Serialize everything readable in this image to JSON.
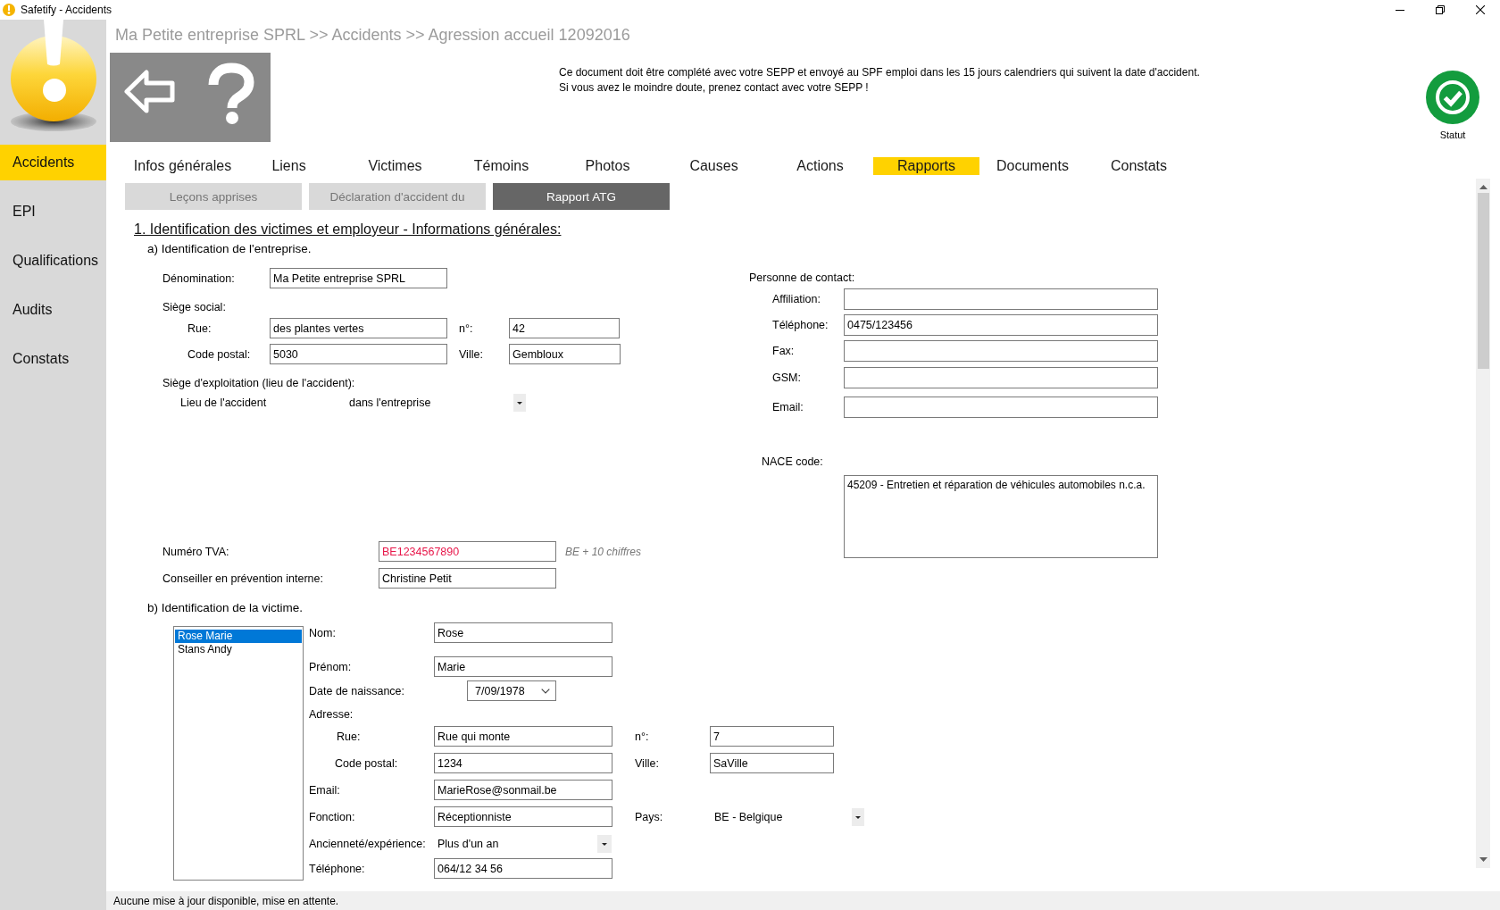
{
  "window": {
    "title": "Safetify - Accidents"
  },
  "sidebar": {
    "items": [
      {
        "label": "Accidents",
        "selected": true
      },
      {
        "label": "EPI",
        "selected": false
      },
      {
        "label": "Qualifications",
        "selected": false
      },
      {
        "label": "Audits",
        "selected": false
      },
      {
        "label": "Constats",
        "selected": false
      }
    ]
  },
  "breadcrumb": "Ma Petite entreprise SPRL >> Accidents >> Agression accueil 12092016",
  "notice": [
    "Ce document doit être complété avec votre SEPP et envoyé au SPF emploi dans les 15 jours calendriers qui suivent la date d'accident.",
    "Si vous avez le moindre doute, prenez contact avec votre SEPP !"
  ],
  "status": {
    "label": "Statut"
  },
  "tabs": [
    {
      "label": "Infos générales",
      "selected": false
    },
    {
      "label": "Liens",
      "selected": false
    },
    {
      "label": "Victimes",
      "selected": false
    },
    {
      "label": "Témoins",
      "selected": false
    },
    {
      "label": "Photos",
      "selected": false
    },
    {
      "label": "Causes",
      "selected": false
    },
    {
      "label": "Actions",
      "selected": false
    },
    {
      "label": "Rapports",
      "selected": true
    },
    {
      "label": "Documents",
      "selected": false
    },
    {
      "label": "Constats",
      "selected": false
    }
  ],
  "subtabs": [
    {
      "label": "Leçons apprises",
      "selected": false
    },
    {
      "label": "Déclaration d'accident du",
      "selected": false
    },
    {
      "label": "Rapport ATG",
      "selected": true
    }
  ],
  "form": {
    "title": "1. Identification des victimes et employeur - Informations générales:",
    "company": {
      "heading": "a) Identification de l'entreprise.",
      "denomination": {
        "label": "Dénomination:",
        "value": "Ma Petite entreprise SPRL"
      },
      "siege_social": {
        "label": "Siège social:",
        "rue": {
          "label": "Rue:",
          "value": "des plantes vertes"
        },
        "numero": {
          "label": "n°:",
          "value": "42"
        },
        "code_postal": {
          "label": "Code postal:",
          "value": "5030"
        },
        "ville": {
          "label": "Ville:",
          "value": "Gembloux"
        }
      },
      "siege_exploitation": {
        "label": "Siège d'exploitation (lieu de l'accident):",
        "lieu": {
          "label": "Lieu de l'accident",
          "value": "dans l'entreprise"
        }
      },
      "tva": {
        "label": "Numéro TVA:",
        "value": "BE1234567890",
        "invalid": true,
        "hint": "BE + 10 chiffres"
      },
      "conseiller": {
        "label": "Conseiller en prévention interne:",
        "value": "Christine Petit"
      }
    },
    "contact": {
      "heading": "Personne de contact:",
      "fields": [
        {
          "label": "Affiliation:"
        },
        {
          "label": "Téléphone:",
          "value": "0475/123456"
        },
        {
          "label": "Fax:"
        },
        {
          "label": "GSM:"
        },
        {
          "label": "Email:"
        }
      ]
    },
    "nace": {
      "label": "NACE code:",
      "value": "45209 - Entretien et réparation de véhicules automobiles n.c.a."
    },
    "victim": {
      "heading": "b) Identification de la victime.",
      "list": [
        {
          "name": "Rose Marie",
          "selected": true
        },
        {
          "name": "Stans Andy",
          "selected": false
        }
      ],
      "nom": {
        "label": "Nom:",
        "value": "Rose"
      },
      "prenom": {
        "label": "Prénom:",
        "value": "Marie"
      },
      "naissance": {
        "label": "Date de naissance:",
        "value": "7/09/1978"
      },
      "adresse": {
        "label": "Adresse:",
        "rue": {
          "label": "Rue:",
          "value": "Rue qui monte"
        },
        "numero": {
          "label": "n°:",
          "value": "7"
        },
        "code_postal": {
          "label": "Code postal:",
          "value": "1234"
        },
        "ville": {
          "label": "Ville:",
          "value": "SaVille"
        }
      },
      "email": {
        "label": "Email:",
        "value": "MarieRose@sonmail.be"
      },
      "fonction": {
        "label": "Fonction:",
        "value": "Réceptionniste"
      },
      "pays": {
        "label": "Pays:",
        "value": "BE - Belgique"
      },
      "anciennete": {
        "label": "Ancienneté/expérience:",
        "value": "Plus d'un an"
      },
      "telephone": {
        "label": "Téléphone:",
        "value": "064/12 34 56"
      }
    }
  },
  "status_bar": "Aucune mise à jour disponible, mise en attente."
}
